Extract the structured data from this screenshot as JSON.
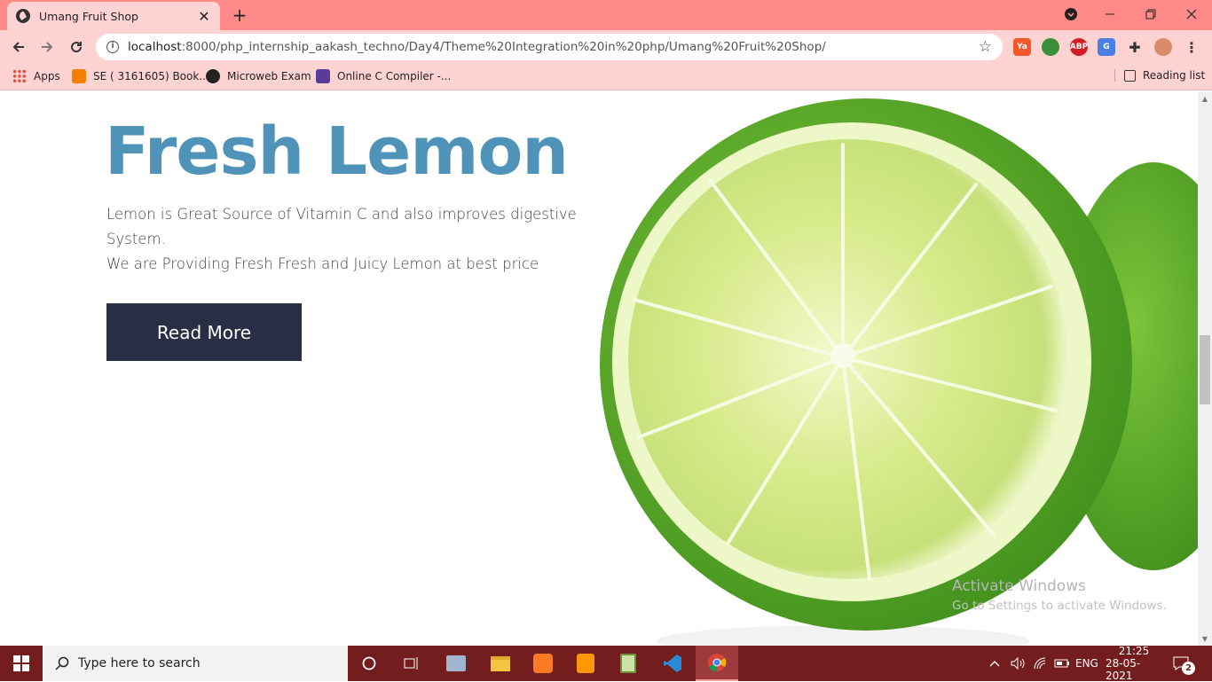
{
  "browser": {
    "tab_title": "Umang Fruit Shop",
    "url_host": "localhost",
    "url_rest": ":8000/php_internship_aakash_techno/Day4/Theme%20Integration%20in%20php/Umang%20Fruit%20Shop/"
  },
  "bookmarks": {
    "items": [
      {
        "label": "Apps"
      },
      {
        "label": "SE ( 3161605) Book..."
      },
      {
        "label": "Microweb Exam"
      },
      {
        "label": "Online C Compiler -..."
      }
    ],
    "reading_list": "Reading list"
  },
  "hero": {
    "title": "Fresh Lemon",
    "line1": "Lemon is Great Source of Vitamin C and also improves digestive System.",
    "line2": "We are Providing Fresh Fresh and Juicy Lemon at best price",
    "button": "Read More"
  },
  "watermark": {
    "title": "Activate Windows",
    "subtitle": "Go to Settings to activate Windows."
  },
  "taskbar": {
    "search_placeholder": "Type here to search",
    "language": "ENG",
    "time": "21:25",
    "date": "28-05-2021",
    "notification_count": "2"
  },
  "colors": {
    "heading": "#4f94b8",
    "button": "#282f45",
    "tabbar": "#ff8a87",
    "toolbar": "#ffd3d2",
    "taskbar": "#741d1f"
  }
}
